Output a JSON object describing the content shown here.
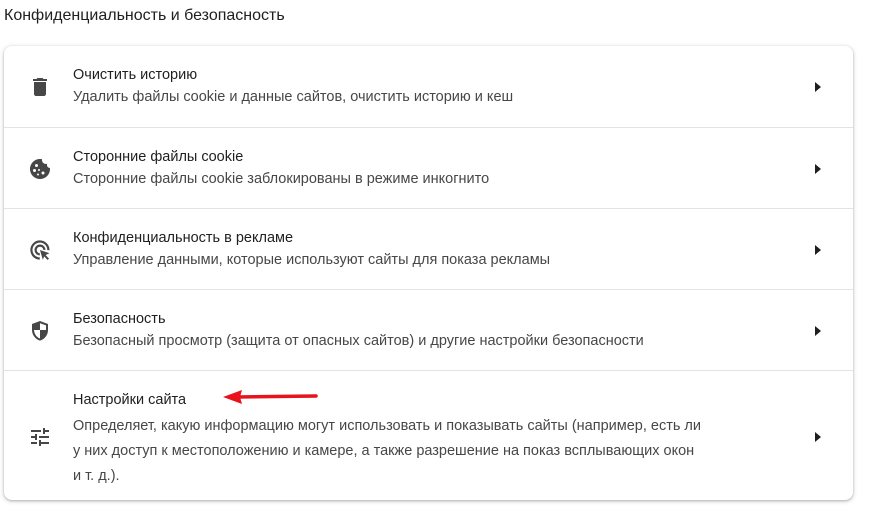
{
  "section": {
    "title": "Конфиденциальность и безопасность"
  },
  "rows": [
    {
      "icon": "trash-icon",
      "title": "Очистить историю",
      "desc": "Удалить файлы cookie и данные сайтов, очистить историю и кеш"
    },
    {
      "icon": "cookie-icon",
      "title": "Сторонние файлы cookie",
      "desc": "Сторонние файлы cookie заблокированы в режиме инкогнито"
    },
    {
      "icon": "ad-privacy-icon",
      "title": "Конфиденциальность в рекламе",
      "desc": "Управление данными, которые используют сайты для показа рекламы"
    },
    {
      "icon": "shield-icon",
      "title": "Безопасность",
      "desc": "Безопасный просмотр (защита от опасных сайтов) и другие настройки безопасности"
    },
    {
      "icon": "tune-icon",
      "title": "Настройки сайта",
      "desc_lines": [
        "Определяет, какую информацию могут использовать и показывать сайты (например, есть ли",
        "у них доступ к местоположению и камере, а также разрешение на показ всплывающих окон",
        "и т. д.)."
      ]
    }
  ],
  "annotation": {
    "type": "red-arrow",
    "color": "#e8121c",
    "points_to": "Настройки сайта"
  },
  "colors": {
    "text_primary": "#1f1f1f",
    "text_secondary": "#474747",
    "icon": "#474747",
    "divider": "#e3e3e3"
  }
}
